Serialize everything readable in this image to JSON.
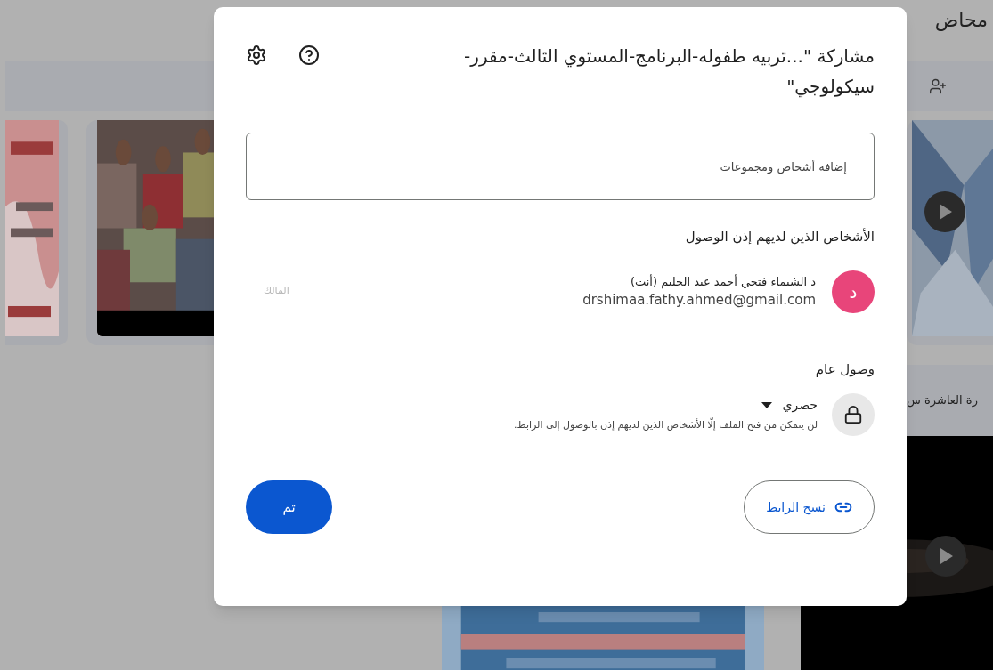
{
  "background": {
    "title": "محاض",
    "side_label": "رة العاشرة س"
  },
  "dialog": {
    "title": "مشاركة \"...تربيه طفوله-البرنامج-المستوي الثالث-مقرر-سيكولوجي\"",
    "add_field": {
      "placeholder": "إضافة أشخاص ومجموعات"
    },
    "people_heading": "الأشخاص الذين لديهم إذن الوصول",
    "people": [
      {
        "initial": "د",
        "color": "#e8457a",
        "name": "د الشيماء فتحي أحمد عبد الحليم (أنت)",
        "email": "drshimaa.fathy.ahmed@gmail.com",
        "role": "المالك"
      }
    ],
    "general_access": {
      "heading": "وصول عام",
      "option": "حصري",
      "description": "لن يتمكن من فتح الملف إلّا الأشخاص الذين لديهم إذن بالوصول إلى الرابط."
    },
    "copy_link_button": "نسخ الرابط",
    "done_button": "تم"
  }
}
